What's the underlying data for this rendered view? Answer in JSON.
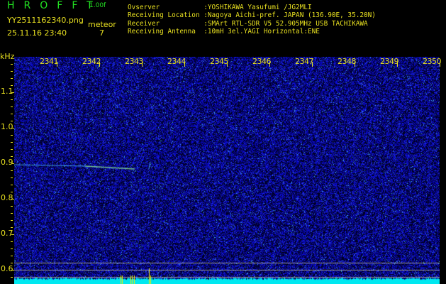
{
  "header": {
    "logo": "HROFFT",
    "version": "1.00f",
    "filename": "YY2511162340.png",
    "datetime": "25.11.16 23:40",
    "meteor_label": "meteor",
    "meteor_count": "7"
  },
  "info": [
    "Ovserver           :YOSHIKAWA Yasufumi /JG2MLI",
    "Receiving Location :Nagoya Aichi-pref. JAPAN (136.90E, 35.20N)",
    "Receiver           :SMArt RTL-SDR V5 52.905MHz USB TACHIKAWA",
    "Receiving Antenna  :10mH 3el.YAGI Horizontal:ENE"
  ],
  "axis": {
    "unit": "kHz",
    "time_labels": [
      "2341",
      "2342",
      "2343",
      "2344",
      "2345",
      "2346",
      "2347",
      "2348",
      "2349",
      "2350"
    ],
    "freq_labels": [
      "1.1",
      "1.0",
      "0.9",
      "0.8",
      "0.7",
      "0.6"
    ]
  },
  "colors": {
    "text": "#e8e020",
    "logo": "#22e022",
    "noise": "#1a1ad0",
    "baseline": "#00e8f0"
  }
}
